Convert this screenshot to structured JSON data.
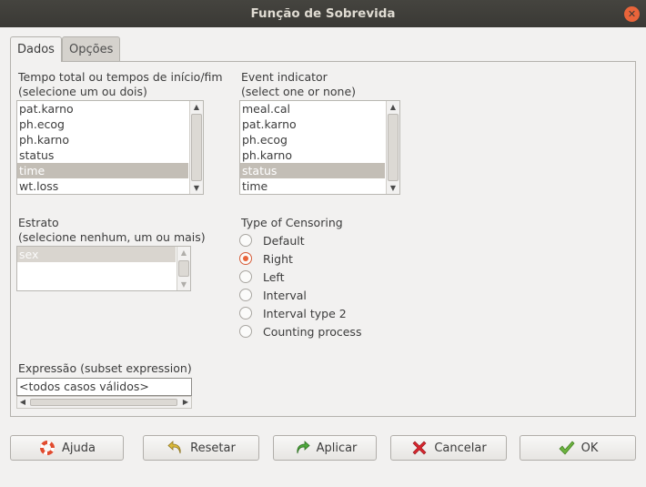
{
  "window": {
    "title": "Função de Sobrevida",
    "close_glyph": "✕"
  },
  "tabs": [
    {
      "label": "Dados",
      "active": true
    },
    {
      "label": "Opções",
      "active": false
    }
  ],
  "time_list": {
    "label_line1": "Tempo total ou tempos de início/fim",
    "label_line2": "(selecione um ou dois)",
    "items": [
      "pat.karno",
      "ph.ecog",
      "ph.karno",
      "status",
      "time",
      "wt.loss"
    ],
    "selected": "time"
  },
  "event_list": {
    "label_line1": "Event indicator",
    "label_line2": "(select one or none)",
    "items": [
      "meal.cal",
      "pat.karno",
      "ph.ecog",
      "ph.karno",
      "status",
      "time"
    ],
    "selected": "status"
  },
  "strata_list": {
    "label_line1": "Estrato",
    "label_line2": "(selecione nenhum, um ou mais)",
    "items": [
      "sex"
    ],
    "selected": "sex"
  },
  "censoring": {
    "label": "Type of Censoring",
    "options": [
      "Default",
      "Right",
      "Left",
      "Interval",
      "Interval type 2",
      "Counting process"
    ],
    "selected": "Right"
  },
  "subset": {
    "label": "Expressão (subset expression)",
    "value": "<todos casos válidos>"
  },
  "buttons": {
    "help": "Ajuda",
    "reset": "Resetar",
    "apply": "Aplicar",
    "cancel": "Cancelar",
    "ok": "OK"
  },
  "colors": {
    "accent": "#e9643a",
    "selection": "#c3beb6",
    "titlebar": "#3c3b37"
  }
}
